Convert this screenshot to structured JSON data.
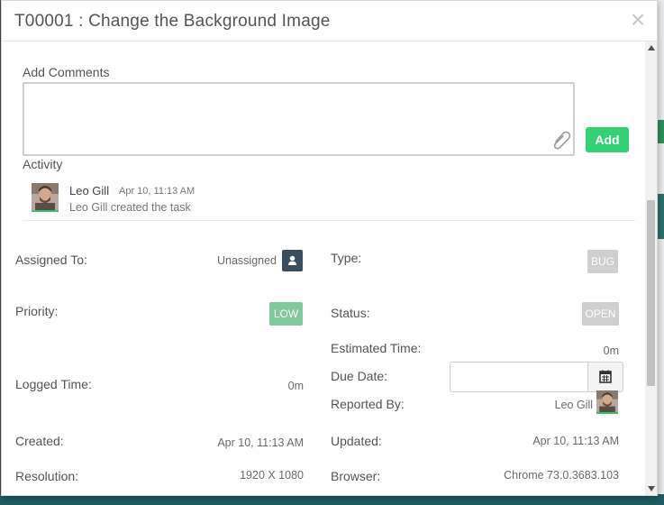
{
  "modal": {
    "title": "T00001 : Change the Background Image",
    "close_label": "×"
  },
  "comments": {
    "label": "Add Comments",
    "value": "",
    "add_button": "Add"
  },
  "activity": {
    "label": "Activity",
    "items": [
      {
        "user": "Leo Gill",
        "time": "Apr 10, 11:13 AM",
        "text": "Leo Gill created the task"
      }
    ]
  },
  "details": {
    "assigned_to": {
      "label": "Assigned To:",
      "value": "Unassigned"
    },
    "type": {
      "label": "Type:",
      "value": "BUG"
    },
    "priority": {
      "label": "Priority:",
      "value": "LOW"
    },
    "status": {
      "label": "Status:",
      "value": "OPEN"
    },
    "estimated_time": {
      "label": "Estimated Time:",
      "value": "0m"
    },
    "logged_time": {
      "label": "Logged Time:",
      "value": "0m"
    },
    "due_date": {
      "label": "Due Date:",
      "value": ""
    },
    "reported_by": {
      "label": "Reported By:",
      "value": "Leo Gill"
    },
    "created": {
      "label": "Created:",
      "value": "Apr 10, 11:13 AM"
    },
    "updated": {
      "label": "Updated:",
      "value": "Apr 10, 11:13 AM"
    },
    "resolution": {
      "label": "Resolution:",
      "value": "1920 X 1080"
    },
    "browser": {
      "label": "Browser:",
      "value": "Chrome 73.0.3683.103"
    }
  },
  "colors": {
    "add_button": "#34d075",
    "priority_low": "#7fc99a",
    "badge_grey": "#cfcfcf",
    "user_button": "#3b4d60"
  },
  "icons": {
    "close": "close-icon",
    "attachment": "paperclip-icon",
    "user": "user-icon",
    "calendar": "calendar-icon"
  }
}
